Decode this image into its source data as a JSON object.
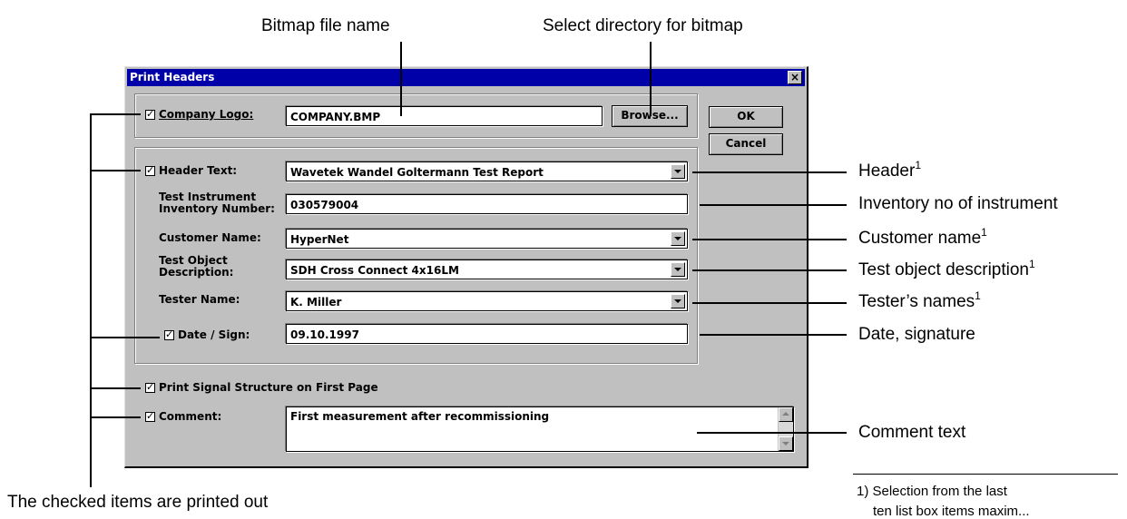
{
  "callouts": {
    "bitmap_file_name": "Bitmap file name",
    "select_directory": "Select directory for bitmap",
    "header": "Header",
    "header_note": "1",
    "inventory": "Inventory no of instrument",
    "customer": "Customer name",
    "customer_note": "1",
    "test_object": "Test object description",
    "test_object_note": "1",
    "tester": "Tester’s names",
    "tester_note": "1",
    "date_signature": "Date, signature",
    "comment_text": "Comment text",
    "checked_items": "The checked items are printed out",
    "footnote": "1) Selection from the last",
    "footnote_cont": "ten list box items maxim..."
  },
  "dialog": {
    "title": "Print Headers",
    "close": "×",
    "company_logo": {
      "label": "Company Logo:",
      "checked": true,
      "value": "COMPANY.BMP"
    },
    "browse_label": "Browse...",
    "ok_label": "OK",
    "cancel_label": "Cancel",
    "header_text": {
      "label": "Header Text:",
      "checked": true,
      "value": "Wavetek Wandel Goltermann Test Report"
    },
    "inventory": {
      "label_line1": "Test Instrument",
      "label_line2": "Inventory Number:",
      "value": "030579004"
    },
    "customer": {
      "label": "Customer Name:",
      "value": "HyperNet"
    },
    "test_object": {
      "label_line1": "Test Object",
      "label_line2": "Description:",
      "value": "SDH Cross Connect 4x16LM"
    },
    "tester": {
      "label": "Tester Name:",
      "value": "K. Miller"
    },
    "date_sign": {
      "label": "Date / Sign:",
      "checked": true,
      "value": "09.10.1997"
    },
    "print_signal_structure": {
      "label": "Print Signal Structure on First Page",
      "checked": true
    },
    "comment": {
      "label": "Comment:",
      "checked": true,
      "value": "First measurement after recommissioning"
    }
  }
}
